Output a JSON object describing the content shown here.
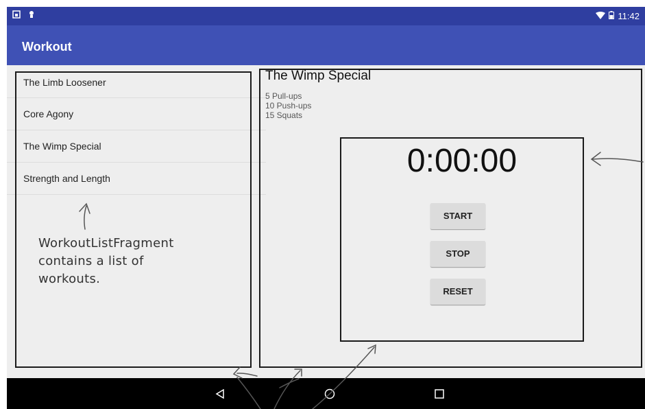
{
  "status_bar": {
    "time": "11:42"
  },
  "app_bar": {
    "title": "Workout"
  },
  "workout_list": {
    "items": [
      {
        "label": "The Limb Loosener"
      },
      {
        "label": "Core Agony"
      },
      {
        "label": "The Wimp Special"
      },
      {
        "label": "Strength and Length"
      }
    ]
  },
  "annotation": {
    "line1": "WorkoutListFragment",
    "line2": "contains a list of",
    "line3": "workouts."
  },
  "workout_detail": {
    "title": "The Wimp Special",
    "lines": [
      "5 Pull-ups",
      "10 Push-ups",
      "15 Squats"
    ]
  },
  "stopwatch": {
    "time": "0:00:00",
    "start_label": "START",
    "stop_label": "STOP",
    "reset_label": "RESET"
  },
  "icons": {
    "status_left": [
      "notification-icon",
      "android-debug-icon"
    ],
    "status_right": [
      "wifi-icon",
      "battery-icon"
    ],
    "nav": [
      "back-icon",
      "home-icon",
      "recents-icon"
    ]
  },
  "colors": {
    "status_bar": "#2f3ea0",
    "app_bar": "#3f51b5",
    "background": "#eeeeee",
    "nav_bar": "#000000"
  }
}
